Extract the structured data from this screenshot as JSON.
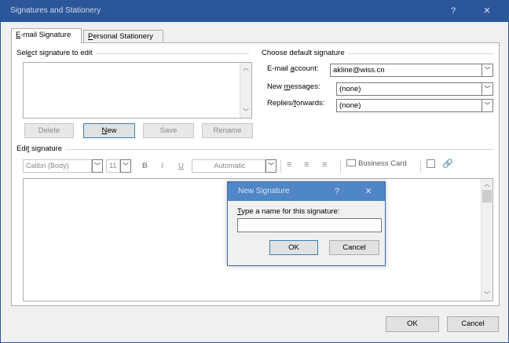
{
  "window": {
    "title": "Signatures and Stationery",
    "help_label": "?",
    "close_label": "✕"
  },
  "tabs": [
    {
      "label": "E-mail Signature",
      "accel": "E",
      "rest": "-mail Signature",
      "active": true
    },
    {
      "label": "Personal Stationery",
      "accel": "P",
      "rest": "ersonal Stationery",
      "active": false
    }
  ],
  "select_section": {
    "label_pre": "Sel",
    "label_accel": "e",
    "label_post": "ct signature to edit",
    "buttons": {
      "delete": "Delete",
      "new_accel": "N",
      "new_rest": "ew",
      "save": "Save",
      "rename": "Rename"
    }
  },
  "default_section": {
    "label": "Choose default signature",
    "email_account_pre": "E-mail ",
    "email_account_accel": "a",
    "email_account_post": "ccount:",
    "email_account_value": "akline@wiss.cn",
    "new_messages_pre": "New ",
    "new_messages_accel": "m",
    "new_messages_post": "essages:",
    "new_messages_value": "(none)",
    "replies_pre": "Replies/",
    "replies_accel": "f",
    "replies_post": "orwards:",
    "replies_value": "(none)"
  },
  "edit_section": {
    "label_pre": "Edi",
    "label_accel": "t",
    "label_post": " signature",
    "font_name": "Calibri (Body)",
    "font_size": "11",
    "bold": "B",
    "italic": "I",
    "underline": "U",
    "color": "Automatic",
    "business_card": "Business Card"
  },
  "new_signature_dialog": {
    "title": "New Signature",
    "help_label": "?",
    "close_label": "✕",
    "prompt_accel": "T",
    "prompt_rest": "ype a name for this signature:",
    "input_value": "",
    "ok": "OK",
    "cancel": "Cancel"
  },
  "footer": {
    "ok": "OK",
    "cancel": "Cancel"
  },
  "colors": {
    "titlebar": "#2b579a",
    "dialog_titlebar": "#4e86c6"
  }
}
